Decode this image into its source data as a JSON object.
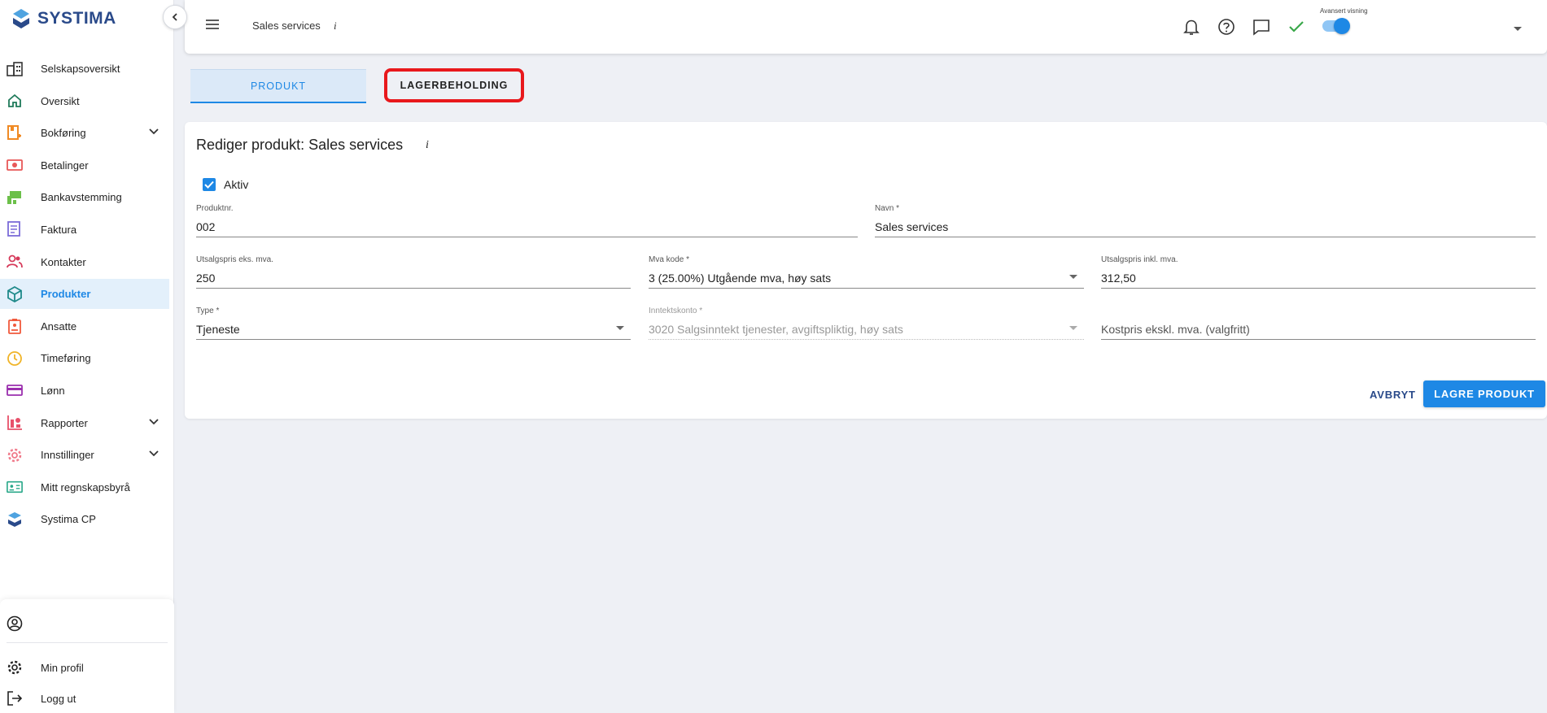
{
  "app": {
    "name": "SYSTIMA",
    "brand_color": "#2a4a8a",
    "accent_color": "#1e88e5"
  },
  "sidebar": {
    "items": [
      {
        "label": "Selskapsoversikt",
        "icon": "building-icon"
      },
      {
        "label": "Oversikt",
        "icon": "home-icon"
      },
      {
        "label": "Bokføring",
        "icon": "bookkeeping-icon",
        "expandable": true
      },
      {
        "label": "Betalinger",
        "icon": "payment-icon"
      },
      {
        "label": "Bankavstemming",
        "icon": "bank-reconcile-icon"
      },
      {
        "label": "Faktura",
        "icon": "invoice-icon"
      },
      {
        "label": "Kontakter",
        "icon": "contacts-icon"
      },
      {
        "label": "Produkter",
        "icon": "cube-icon",
        "active": true
      },
      {
        "label": "Ansatte",
        "icon": "badge-icon"
      },
      {
        "label": "Timeføring",
        "icon": "clock-icon"
      },
      {
        "label": "Lønn",
        "icon": "card-icon"
      },
      {
        "label": "Rapporter",
        "icon": "reports-icon",
        "expandable": true
      },
      {
        "label": "Innstillinger",
        "icon": "gear-icon",
        "expandable": true
      },
      {
        "label": "Mitt regnskapsbyrå",
        "icon": "id-card-icon"
      },
      {
        "label": "Systima CP",
        "icon": "systima-icon"
      }
    ],
    "bottom": {
      "profile": "Min profil",
      "logout": "Logg ut"
    }
  },
  "topbar": {
    "title": "Sales services",
    "info": "i",
    "advanced_view_label": "Avansert visning",
    "advanced_view_on": true
  },
  "tabs": [
    {
      "label": "PRODUKT",
      "active": true
    },
    {
      "label": "LAGERBEHOLDING",
      "active": false
    }
  ],
  "form": {
    "title": "Rediger produkt: Sales services",
    "info": "i",
    "aktiv": {
      "label": "Aktiv",
      "checked": true
    },
    "produktnr": {
      "label": "Produktnr.",
      "value": "002"
    },
    "navn": {
      "label": "Navn *",
      "value": "Sales services"
    },
    "utsalgspris_eks": {
      "label": "Utsalgspris eks. mva.",
      "value": "250"
    },
    "mva_kode": {
      "label": "Mva kode *",
      "value": "3 (25.00%) Utgående mva, høy sats"
    },
    "utsalgspris_inkl": {
      "label": "Utsalgspris inkl. mva.",
      "value": "312,50"
    },
    "type": {
      "label": "Type *",
      "value": "Tjeneste"
    },
    "inntektskonto": {
      "label": "Inntektskonto *",
      "value": "3020 Salgsinntekt tjenester, avgiftspliktig, høy sats",
      "disabled": true
    },
    "kostpris": {
      "placeholder": "Kostpris ekskl. mva. (valgfritt)"
    },
    "cancel_label": "AVBRYT",
    "save_label": "LAGRE PRODUKT"
  }
}
